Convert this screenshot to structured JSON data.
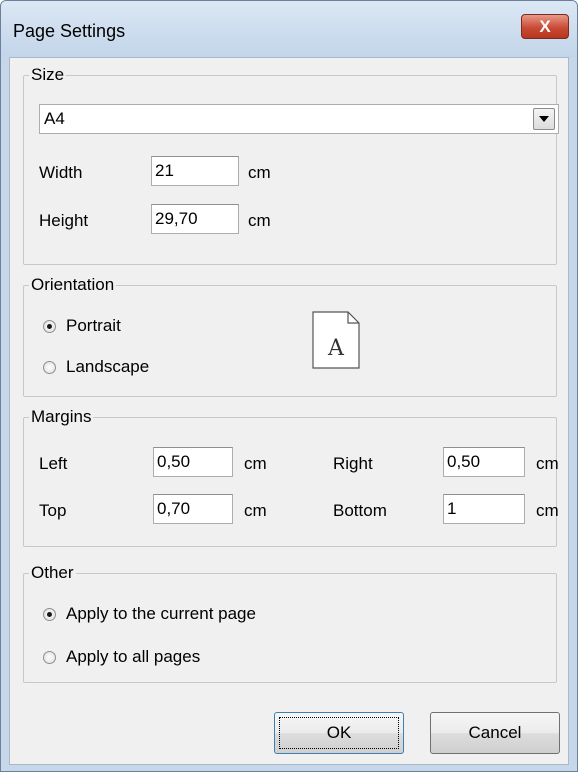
{
  "window": {
    "title": "Page Settings",
    "close_label": "X"
  },
  "size": {
    "legend": "Size",
    "paper": {
      "value": "A4"
    },
    "width": {
      "label": "Width",
      "value": "21",
      "unit": "cm"
    },
    "height": {
      "label": "Height",
      "value": "29,70",
      "unit": "cm"
    }
  },
  "orientation": {
    "legend": "Orientation",
    "options": [
      {
        "label": "Portrait",
        "selected": true
      },
      {
        "label": "Landscape",
        "selected": false
      }
    ],
    "preview_glyph": "A"
  },
  "margins": {
    "legend": "Margins",
    "left": {
      "label": "Left",
      "value": "0,50",
      "unit": "cm"
    },
    "right": {
      "label": "Right",
      "value": "0,50",
      "unit": "cm"
    },
    "top": {
      "label": "Top",
      "value": "0,70",
      "unit": "cm"
    },
    "bottom": {
      "label": "Bottom",
      "value": "1",
      "unit": "cm"
    }
  },
  "other": {
    "legend": "Other",
    "options": [
      {
        "label": "Apply to the current page",
        "selected": true
      },
      {
        "label": "Apply to all pages",
        "selected": false
      }
    ]
  },
  "buttons": {
    "ok": "OK",
    "cancel": "Cancel"
  },
  "colors": {
    "close_button": "#c94b35",
    "window_frame": "#c6d7ea",
    "dialog_bg": "#f0f0f0"
  }
}
